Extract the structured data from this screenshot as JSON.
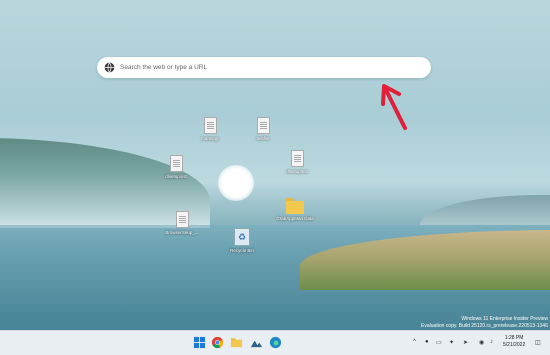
{
  "desktop": {
    "search": {
      "placeholder": "Search the web or type a URL"
    },
    "icons": [
      {
        "label": "mattepgr"
      },
      {
        "label": "testfile"
      },
      {
        "label": "dlsetupinst"
      },
      {
        "label": "dlsetupinst"
      },
      {
        "label": "BrowserSeup_..."
      },
      {
        "label": "GrabAppMan Data"
      },
      {
        "label": "Recycle Bin"
      }
    ],
    "watermark": {
      "line1": "Windows 11 Enterprise Insider Preview",
      "line2": "Evaluation copy. Build 25120.rs_prerelease.220513-1346"
    },
    "arrow_color": "#e0203a"
  },
  "taskbar": {
    "apps": [
      "windows-start-icon",
      "chrome-icon",
      "file-explorer-icon",
      "photos-icon",
      "edge-icon"
    ],
    "clock": {
      "time": "1:28 PM",
      "date": "5/21/2022"
    },
    "tray_chevron": "^"
  }
}
